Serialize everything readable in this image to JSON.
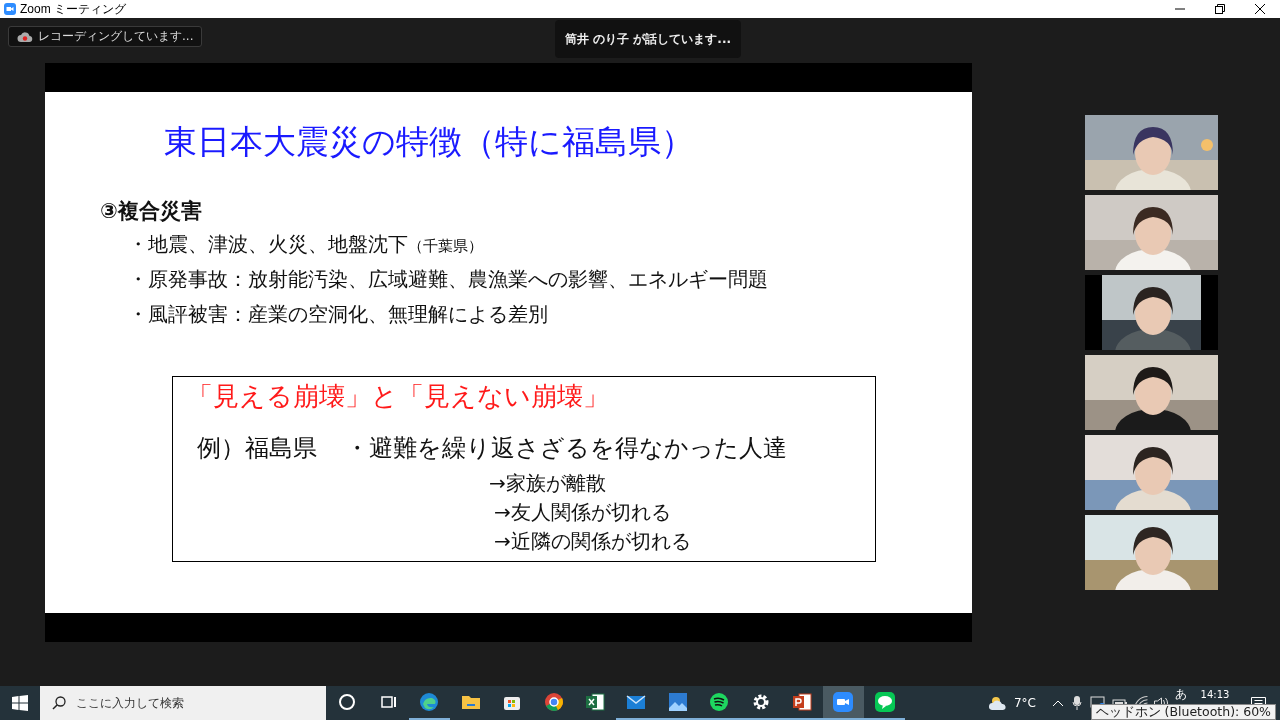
{
  "window": {
    "title": "Zoom ミーティング"
  },
  "recording_badge": "レコーディングしています...",
  "speaker_banner": "筒井 のり子 が話しています...",
  "slide": {
    "title": "東日本大震災の特徴（特に福島県）",
    "heading": "③複合災害",
    "bullets": [
      {
        "text": "・地震、津波、火災、地盤沈下",
        "note": "（千葉県）"
      },
      {
        "text": "・原発事故：放射能汚染、広域避難、農漁業への影響、エネルギー問題"
      },
      {
        "text": "・風評被害：産業の空洞化、無理解による差別"
      }
    ],
    "box": {
      "heading": "「見える崩壊」と「見えない崩壊」",
      "example_label": "例）福島県",
      "example_text": "・避難を繰り返さざるを得なかった人達",
      "consequences": [
        "→家族が離散",
        "→友人関係が切れる",
        "→近隣の関係が切れる"
      ]
    }
  },
  "taskbar": {
    "search": {
      "placeholder": "ここに入力して検索"
    },
    "apps": [
      {
        "kind": "cortana",
        "running": false,
        "selected": false
      },
      {
        "kind": "taskview",
        "running": false,
        "selected": false
      },
      {
        "kind": "edge",
        "running": true,
        "selected": false
      },
      {
        "kind": "folder",
        "running": false,
        "selected": false
      },
      {
        "kind": "store",
        "running": false,
        "selected": false
      },
      {
        "kind": "chrome",
        "running": false,
        "selected": false
      },
      {
        "kind": "excel",
        "running": false,
        "selected": false
      },
      {
        "kind": "mail",
        "running": true,
        "selected": false
      },
      {
        "kind": "photos",
        "running": true,
        "selected": false
      },
      {
        "kind": "spotify",
        "running": true,
        "selected": false
      },
      {
        "kind": "settings",
        "running": true,
        "selected": false
      },
      {
        "kind": "powerpoint",
        "running": true,
        "selected": false
      },
      {
        "kind": "zoom",
        "running": true,
        "selected": true
      },
      {
        "kind": "line",
        "running": true,
        "selected": false
      }
    ],
    "temperature": "7°C",
    "ime": "あ",
    "time": "14:13",
    "tooltip": "ヘッドホン (Bluetooth): 60%"
  }
}
